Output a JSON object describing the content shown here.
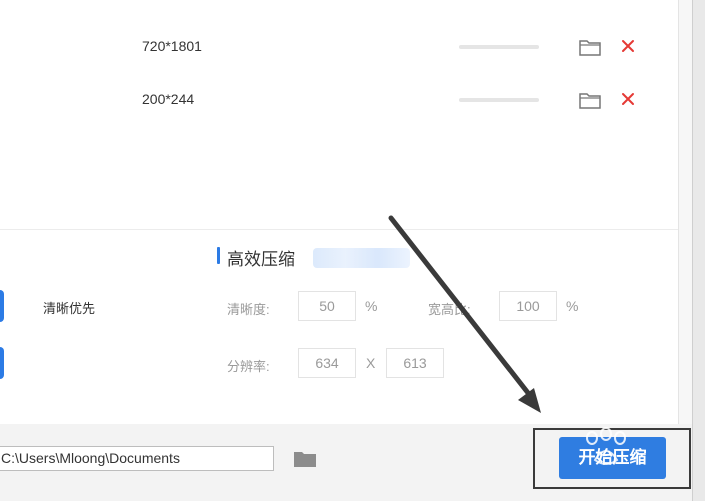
{
  "file_rows": [
    {
      "dimensions": "720*1801"
    },
    {
      "dimensions": "200*244"
    }
  ],
  "section": {
    "title": "高效压缩"
  },
  "options": {
    "clarity_priority_label": "清晰优先"
  },
  "fields": {
    "clarity_label": "清晰度:",
    "clarity_value": "50",
    "clarity_unit": "%",
    "aspect_label": "宽高比:",
    "aspect_value": "100",
    "aspect_unit": "%",
    "resolution_label": "分辨率:",
    "width_value": "634",
    "times_sign": "X",
    "height_value": "613"
  },
  "output": {
    "path": "C:\\Users\\Mloong\\Documents"
  },
  "actions": {
    "start_label": "开始压缩"
  },
  "colors": {
    "accent": "#2f7de1",
    "delete": "#e53935"
  },
  "icons": {
    "folder": "folder-icon",
    "delete": "close-icon"
  }
}
